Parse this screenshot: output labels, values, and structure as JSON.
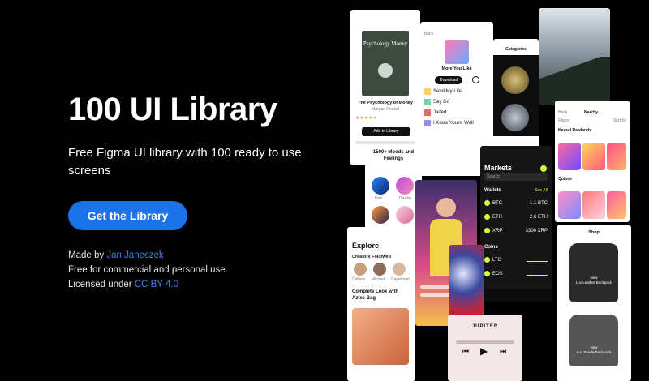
{
  "hero": {
    "title": "100 UI Library",
    "subtitle": "Free Figma UI library with 100 ready to use screens",
    "cta_label": "Get the Library",
    "made_by_prefix": "Made by ",
    "author": "Jan Janeczek",
    "usage": "Free for commercial and personal use.",
    "license_prefix": "Licensed under ",
    "license": "CC BY 4.0"
  },
  "mockups": {
    "book": {
      "cover": "Psychology Money",
      "title": "The Psychology of Money",
      "author": "Morgan Housel",
      "button": "Add to Library"
    },
    "music": {
      "back": "Back",
      "heading": "More You Like",
      "download": "Download",
      "tracks": [
        "Send My Life",
        "Say Go",
        "Jaded",
        "I Know You're Well"
      ]
    },
    "categories": {
      "title": "Categories"
    },
    "moods": {
      "title": "1500+ Moods and Feelings",
      "items": [
        "Deo",
        "Dazzle"
      ]
    },
    "markets": {
      "title": "Markets",
      "search": "Search",
      "wallets": "Wallets",
      "see_all": "See All",
      "coins": "Coins",
      "rows": [
        [
          "BTC",
          "1.1 BTC"
        ],
        [
          "ETH",
          "2.6 ETH"
        ],
        [
          "XRP",
          "3300 XRP"
        ],
        [
          "LTC",
          ""
        ],
        [
          "EOS",
          ""
        ]
      ]
    },
    "filters": {
      "back": "Back",
      "nearby": "Nearby",
      "filters": "Filters",
      "sort": "Sort by",
      "sellers": [
        "Kessel Rawlands",
        "Quince"
      ]
    },
    "explore": {
      "title": "Explore",
      "creators": "Creators Followed",
      "names": [
        "Cellass",
        "Mitchell",
        "Capelorah"
      ],
      "card": "Complete Look with Aztec Bag"
    },
    "player": {
      "track": "JUPITER"
    },
    "shop": {
      "title": "Shop",
      "tags": [
        "New",
        "Lux Leather Backpack",
        "New",
        "Lux Suede Backpack"
      ]
    }
  }
}
